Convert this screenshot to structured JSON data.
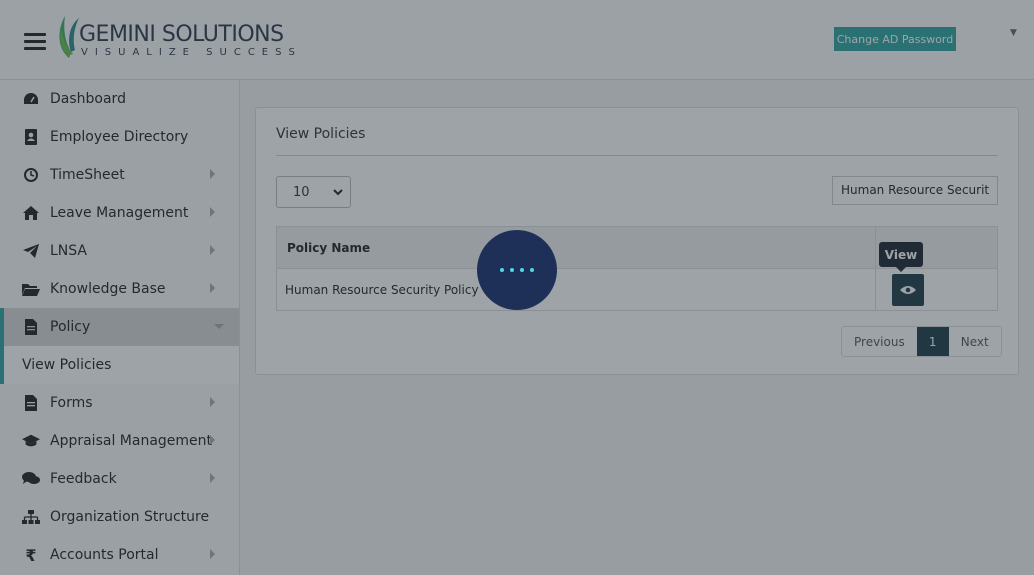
{
  "header": {
    "logo_title": "GEMINI SOLUTIONS",
    "logo_tagline": "VISUALIZE SUCCESS",
    "change_password_label": "Change AD Password"
  },
  "sidebar": {
    "items": [
      {
        "label": "Dashboard",
        "icon": "dashboard-icon"
      },
      {
        "label": "Employee Directory",
        "icon": "address-book-icon"
      },
      {
        "label": "TimeSheet",
        "icon": "clock-icon"
      },
      {
        "label": "Leave Management",
        "icon": "home-icon"
      },
      {
        "label": "LNSA",
        "icon": "paper-plane-icon"
      },
      {
        "label": "Knowledge Base",
        "icon": "folder-open-icon"
      },
      {
        "label": "Policy",
        "icon": "file-text-icon"
      },
      {
        "label": "Forms",
        "icon": "file-text-icon"
      },
      {
        "label": "Appraisal Management",
        "icon": "graduation-cap-icon"
      },
      {
        "label": "Feedback",
        "icon": "comments-icon"
      },
      {
        "label": "Organization Structure",
        "icon": "sitemap-icon"
      },
      {
        "label": "Accounts Portal",
        "icon": "rupee-icon"
      }
    ],
    "sub_item_label": "View Policies"
  },
  "main": {
    "card_title": "View Policies",
    "page_size": "10",
    "search_value": "Human Resource Securit",
    "table": {
      "columns": [
        "Policy Name",
        ""
      ],
      "rows": [
        {
          "policy_name": "Human Resource Security Policy"
        }
      ]
    },
    "tooltip": "View",
    "pagination": {
      "previous": "Previous",
      "current": "1",
      "next": "Next"
    }
  },
  "colors": {
    "accent": "#2ca5a0",
    "dark_button": "#1c3b44",
    "loader_bg": "#1e2f58",
    "loader_dots": "#4fd8e6"
  }
}
